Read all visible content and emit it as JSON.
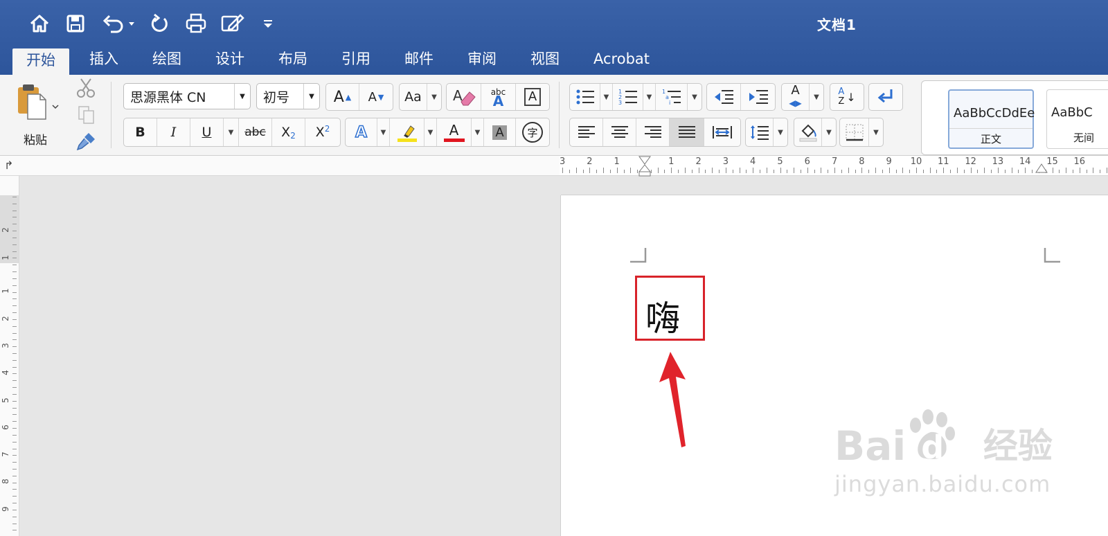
{
  "window": {
    "title": "文档1"
  },
  "quick_access": {
    "icons": [
      "home-icon",
      "save-icon",
      "undo-icon",
      "redo-icon",
      "print-icon",
      "edit-doc-icon",
      "customize-icon"
    ]
  },
  "tabs": [
    {
      "label": "开始",
      "active": true
    },
    {
      "label": "插入"
    },
    {
      "label": "绘图"
    },
    {
      "label": "设计"
    },
    {
      "label": "布局"
    },
    {
      "label": "引用"
    },
    {
      "label": "邮件"
    },
    {
      "label": "审阅"
    },
    {
      "label": "视图"
    },
    {
      "label": "Acrobat"
    }
  ],
  "clipboard": {
    "paste_label": "粘贴"
  },
  "font": {
    "name": "思源黑体 CN",
    "size": "初号"
  },
  "font_buttons": {
    "bold": "B",
    "italic": "I",
    "underline": "U",
    "strike": "abc",
    "sub": "X",
    "sub_index": "2",
    "sup": "X",
    "sup_index": "2",
    "text_effects": "A",
    "font_color": "A",
    "char_shading": "A",
    "enclose": "字",
    "grow": "A",
    "shrink": "A",
    "change_case": "Aa",
    "phonetic_top": "abc",
    "phonetic_bottom": "A",
    "border": "A"
  },
  "paragraph_buttons": {
    "sort_top": "A",
    "sort_bottom": "Z",
    "shading_a": "A"
  },
  "styles": [
    {
      "preview": "AaBbCcDdEe",
      "label": "正文",
      "selected": true
    },
    {
      "preview": "AaBbC",
      "label": "无间"
    }
  ],
  "colors": {
    "accent": "#2d559b",
    "highlight": "#f5e11c",
    "font_color": "#e0151f",
    "annotation": "#d8232a"
  },
  "ruler": {
    "horizontal_left": [
      "3",
      "2",
      "1"
    ],
    "horizontal_right": [
      "1",
      "2",
      "3",
      "4",
      "5",
      "6",
      "7",
      "8",
      "9",
      "10",
      "11",
      "12",
      "13",
      "14",
      "15",
      "16"
    ],
    "vertical_top": [
      "2",
      "1"
    ],
    "vertical_bottom": [
      "1",
      "2",
      "3",
      "4",
      "5",
      "6",
      "7",
      "8",
      "9"
    ]
  },
  "document": {
    "text": "嗨"
  },
  "watermark": {
    "brand": "Bai",
    "brand2": "du",
    "product": "经验",
    "url": "jingyan.baidu.com"
  }
}
